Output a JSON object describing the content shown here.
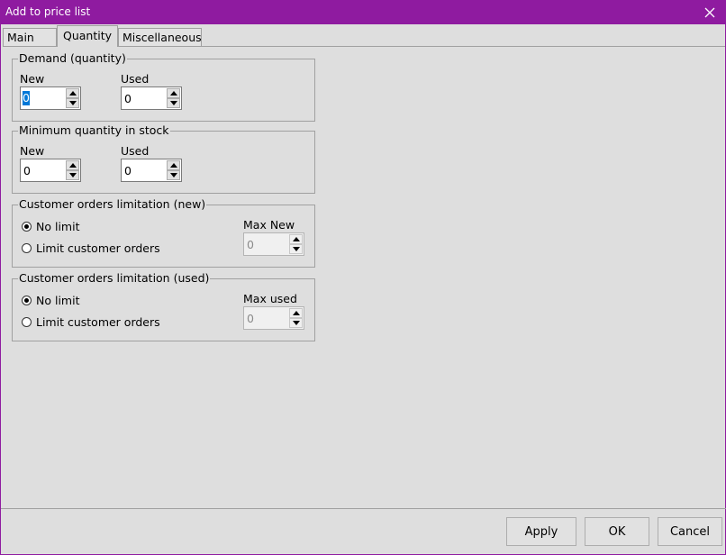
{
  "window": {
    "title": "Add to price list"
  },
  "tabs": [
    {
      "label": "Main",
      "active": false
    },
    {
      "label": "Quantity",
      "active": true
    },
    {
      "label": "Miscellaneous",
      "active": false
    }
  ],
  "demand": {
    "legend": "Demand (quantity)",
    "new_label": "New",
    "new_value": "0",
    "used_label": "Used",
    "used_value": "0"
  },
  "min_stock": {
    "legend": "Minimum quantity in stock",
    "new_label": "New",
    "new_value": "0",
    "used_label": "Used",
    "used_value": "0"
  },
  "limit_new": {
    "legend": "Customer orders limitation (new)",
    "option_no_limit": "No limit",
    "option_limit": "Limit customer orders",
    "selected": "no_limit",
    "max_label": "Max New",
    "max_value": "0"
  },
  "limit_used": {
    "legend": "Customer orders limitation (used)",
    "option_no_limit": "No limit",
    "option_limit": "Limit customer orders",
    "selected": "no_limit",
    "max_label": "Max used",
    "max_value": "0"
  },
  "buttons": {
    "apply": "Apply",
    "ok": "OK",
    "cancel": "Cancel"
  },
  "colors": {
    "titlebar": "#8f1ba0",
    "selection": "#0078d7",
    "background": "#dedede"
  }
}
